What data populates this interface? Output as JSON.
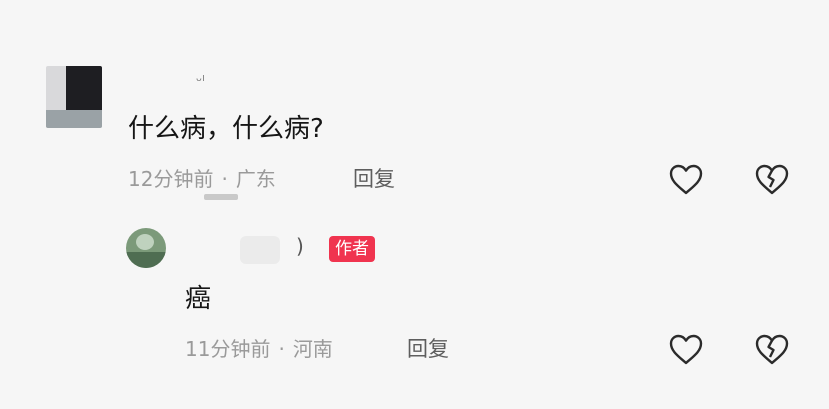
{
  "comments": [
    {
      "name_fragment": "ᵕˡ",
      "text": "什么病，什么病?",
      "time": "12分钟前",
      "location": "广东",
      "reply_label": "回复"
    },
    {
      "name_fragment": ")",
      "badge": "作者",
      "text": "癌",
      "time": "11分钟前",
      "location": "河南",
      "reply_label": "回复"
    }
  ],
  "separator": "·",
  "icons": {
    "like": "heart-outline-icon",
    "dislike": "broken-heart-icon"
  }
}
